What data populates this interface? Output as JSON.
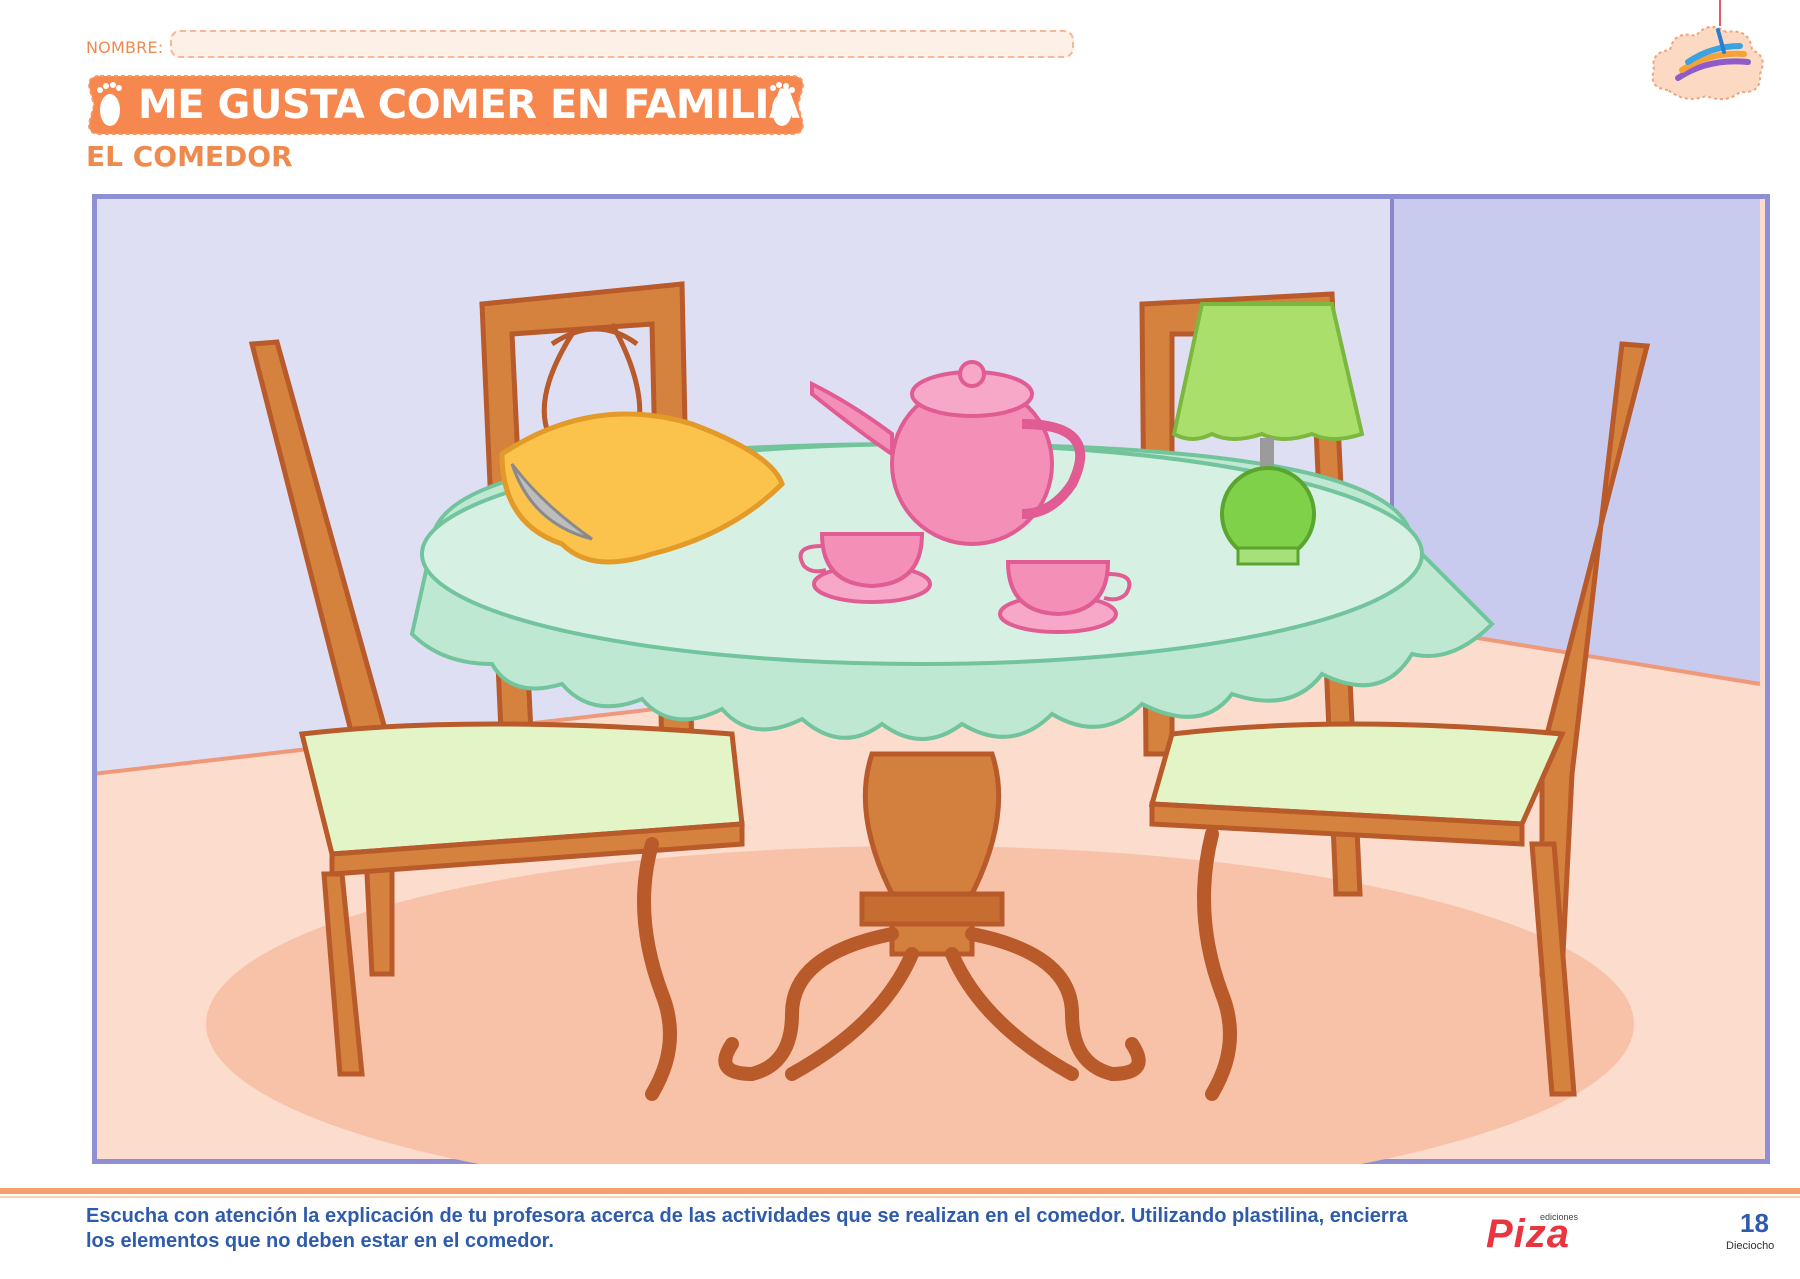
{
  "header": {
    "name_label": "NOMBRE:",
    "title": "ME GUSTA COMER EN FAMILIA",
    "subtitle": "EL COMEDOR"
  },
  "footer": {
    "instructions": "Escucha con atención la explicación de tu profesora acerca de las actividades que se realizan en el comedor. Utilizando plastilina, encierra los elementos que no deben estar en el comedor.",
    "brand_small": "ediciones",
    "brand_name": "Piza",
    "page_number": "18",
    "page_word": "Dieciocho"
  },
  "colors": {
    "accent_orange": "#ef8a4e",
    "footer_text_blue": "#2e5bab",
    "wall": "#dcdcf2",
    "floor": "#fbdccd",
    "tablecloth": "#bfe8d2"
  }
}
